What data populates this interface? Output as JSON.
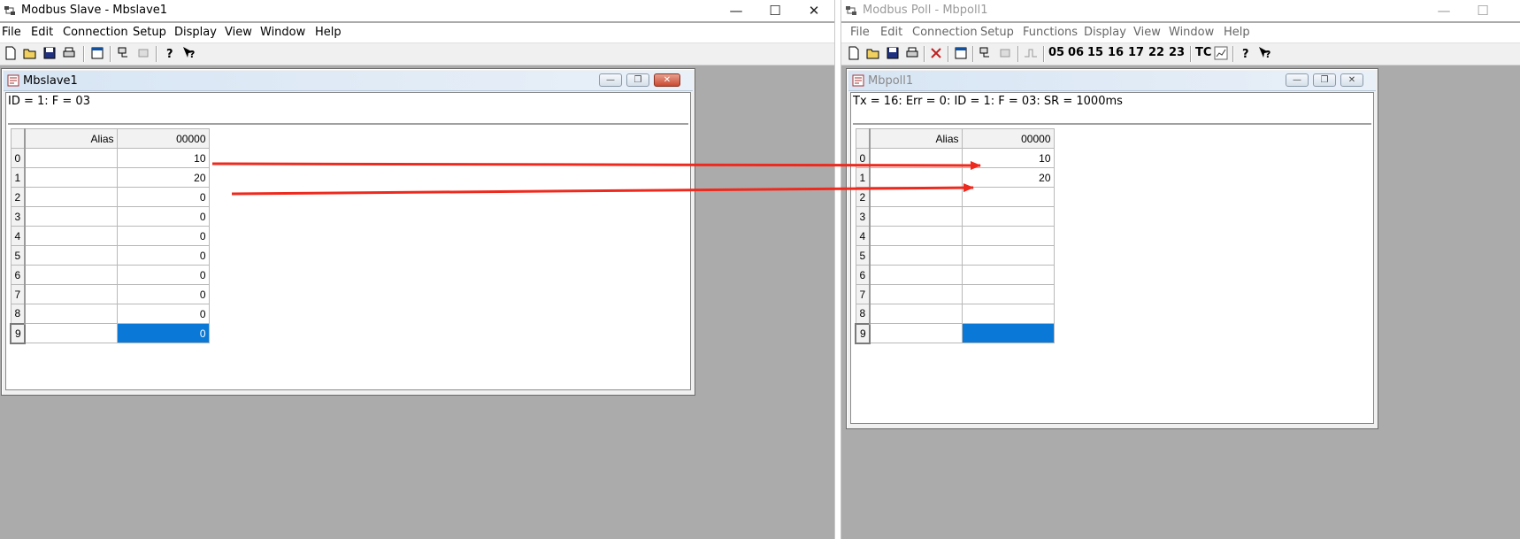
{
  "slave": {
    "window_title": "Modbus Slave - Mbslave1",
    "menu": [
      "File",
      "Edit",
      "Connection",
      "Setup",
      "Display",
      "View",
      "Window",
      "Help"
    ],
    "mdi_title": "Mbslave1",
    "status": "ID = 1: F = 03",
    "grid": {
      "alias_header": "Alias",
      "col_header": "00000",
      "rows": [
        {
          "index": "0",
          "value": "10"
        },
        {
          "index": "1",
          "value": "20"
        },
        {
          "index": "2",
          "value": "0"
        },
        {
          "index": "3",
          "value": "0"
        },
        {
          "index": "4",
          "value": "0"
        },
        {
          "index": "5",
          "value": "0"
        },
        {
          "index": "6",
          "value": "0"
        },
        {
          "index": "7",
          "value": "0"
        },
        {
          "index": "8",
          "value": "0"
        },
        {
          "index": "9",
          "value": "0"
        }
      ]
    }
  },
  "poll": {
    "window_title": "Modbus Poll - Mbpoll1",
    "menu": [
      "File",
      "Edit",
      "Connection",
      "Setup",
      "Functions",
      "Display",
      "View",
      "Window",
      "Help"
    ],
    "function_codes": [
      "05",
      "06",
      "15",
      "16",
      "17",
      "22",
      "23"
    ],
    "tc_label": "TC",
    "mdi_title": "Mbpoll1",
    "status": "Tx = 16: Err = 0: ID = 1: F = 03: SR = 1000ms",
    "grid": {
      "alias_header": "Alias",
      "col_header": "00000",
      "rows": [
        {
          "index": "0",
          "value": "10"
        },
        {
          "index": "1",
          "value": "20"
        },
        {
          "index": "2",
          "value": ""
        },
        {
          "index": "3",
          "value": ""
        },
        {
          "index": "4",
          "value": ""
        },
        {
          "index": "5",
          "value": ""
        },
        {
          "index": "6",
          "value": ""
        },
        {
          "index": "7",
          "value": ""
        },
        {
          "index": "8",
          "value": ""
        },
        {
          "index": "9",
          "value": ""
        }
      ]
    }
  },
  "colors": {
    "selection": "#0a78d7",
    "arrow": "#ee2a1e",
    "desktop": "#ababab"
  }
}
